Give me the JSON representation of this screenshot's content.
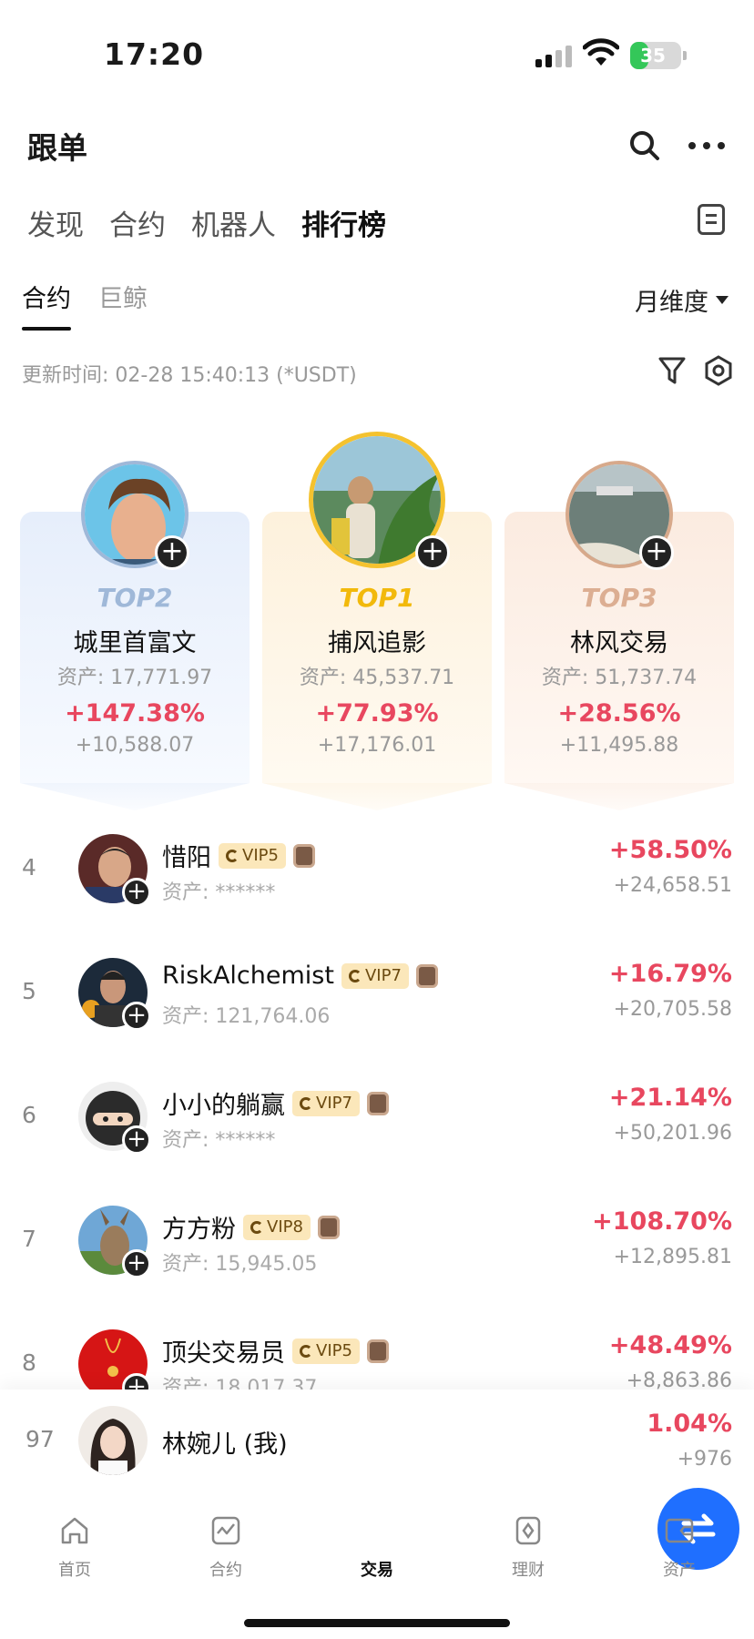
{
  "status_bar": {
    "time": "17:20",
    "battery": "35"
  },
  "header": {
    "title": "跟单"
  },
  "main_tabs": [
    {
      "label": "发现"
    },
    {
      "label": "合约"
    },
    {
      "label": "机器人"
    },
    {
      "label": "排行榜"
    }
  ],
  "main_tabs_active": "排行榜",
  "sub_tabs": [
    {
      "label": "合约"
    },
    {
      "label": "巨鲸"
    }
  ],
  "period_select": "月维度",
  "update_line": "更新时间: 02-28 15:40:13 (*USDT)",
  "podium": [
    {
      "rank_label": "TOP2",
      "name": "城里首富文",
      "assets": "资产: 17,771.97",
      "pct": "+147.38%",
      "pnl": "+10,588.07"
    },
    {
      "rank_label": "TOP1",
      "name": "捕风追影",
      "assets": "资产: 45,537.71",
      "pct": "+77.93%",
      "pnl": "+17,176.01"
    },
    {
      "rank_label": "TOP3",
      "name": "林风交易",
      "assets": "资产: 51,737.74",
      "pct": "+28.56%",
      "pnl": "+11,495.88"
    }
  ],
  "list": [
    {
      "rank": "4",
      "name": "惜阳",
      "vip": "VIP5",
      "assets": "资产: ******",
      "pct": "+58.50%",
      "pnl": "+24,658.51"
    },
    {
      "rank": "5",
      "name": "RiskAlchemist",
      "vip": "VIP7",
      "assets": "资产: 121,764.06",
      "pct": "+16.79%",
      "pnl": "+20,705.58"
    },
    {
      "rank": "6",
      "name": "小小的躺赢",
      "vip": "VIP7",
      "assets": "资产: ******",
      "pct": "+21.14%",
      "pnl": "+50,201.96"
    },
    {
      "rank": "7",
      "name": "方方粉",
      "vip": "VIP8",
      "assets": "资产: 15,945.05",
      "pct": "+108.70%",
      "pnl": "+12,895.81"
    },
    {
      "rank": "8",
      "name": "顶尖交易员",
      "vip": "VIP5",
      "assets": "资产: 18,017.37",
      "pct": "+48.49%",
      "pnl": "+8,863.86"
    }
  ],
  "me": {
    "rank": "97",
    "name": "林婉儿 (我)",
    "pct": "1.04%",
    "pnl": "+976"
  },
  "bottom_nav": [
    {
      "label": "首页",
      "icon": "home-icon"
    },
    {
      "label": "合约",
      "icon": "chart-icon"
    },
    {
      "label": "交易",
      "icon": "swap-icon"
    },
    {
      "label": "理财",
      "icon": "finance-icon"
    },
    {
      "label": "资产",
      "icon": "wallet-icon"
    }
  ],
  "colors": {
    "accent_red": "#e8475f",
    "fab_blue": "#1f6fff",
    "gold": "#f2b90b"
  }
}
